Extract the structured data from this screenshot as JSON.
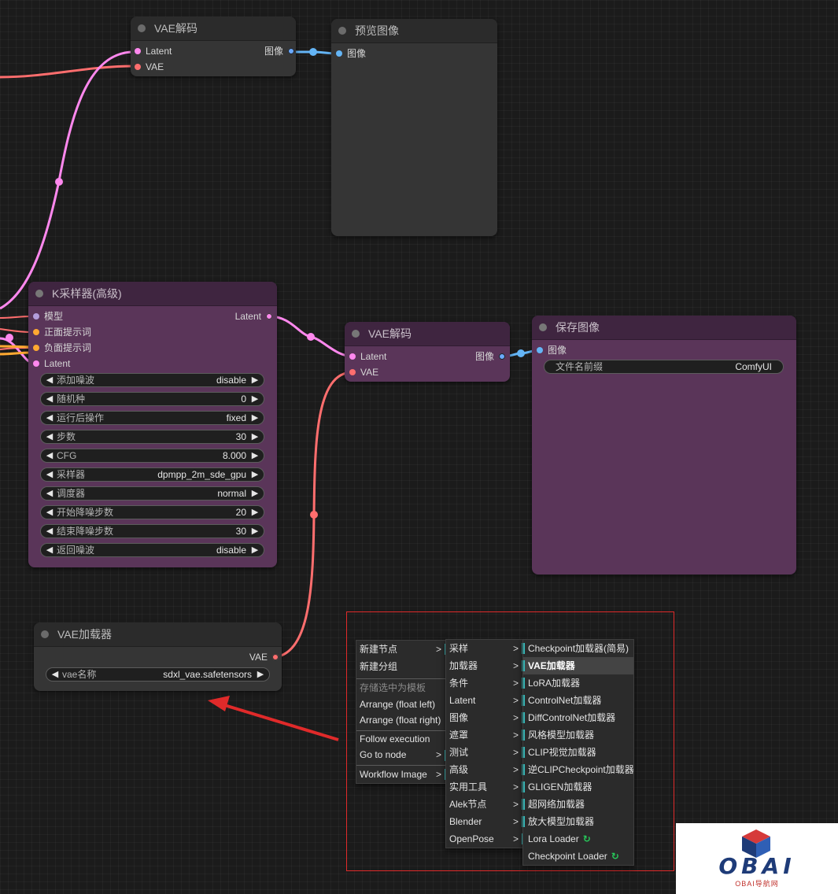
{
  "top_vae_decode": {
    "title": "VAE解码",
    "inputs": [
      "Latent",
      "VAE"
    ],
    "output": "图像"
  },
  "preview_image": {
    "title": "预览图像",
    "input": "图像"
  },
  "ksampler": {
    "title": "K采样器(高级)",
    "inputs": [
      "模型",
      "正面提示词",
      "负面提示词",
      "Latent"
    ],
    "output": "Latent",
    "widgets": [
      {
        "label": "添加噪波",
        "value": "disable"
      },
      {
        "label": "随机种",
        "value": "0"
      },
      {
        "label": "运行后操作",
        "value": "fixed"
      },
      {
        "label": "步数",
        "value": "30"
      },
      {
        "label": "CFG",
        "value": "8.000"
      },
      {
        "label": "采样器",
        "value": "dpmpp_2m_sde_gpu"
      },
      {
        "label": "调度器",
        "value": "normal"
      },
      {
        "label": "开始降噪步数",
        "value": "20"
      },
      {
        "label": "结束降噪步数",
        "value": "30"
      },
      {
        "label": "返回噪波",
        "value": "disable"
      }
    ]
  },
  "mid_vae_decode": {
    "title": "VAE解码",
    "inputs": [
      "Latent",
      "VAE"
    ],
    "output": "图像"
  },
  "save_image": {
    "title": "保存图像",
    "input": "图像",
    "widget": {
      "label": "文件名前缀",
      "value": "ComfyUI"
    }
  },
  "vae_loader": {
    "title": "VAE加载器",
    "output": "VAE",
    "widget": {
      "label": "vae名称",
      "value": "sdxl_vae.safetensors"
    }
  },
  "context_menu": {
    "level1": [
      {
        "label": "新建节点",
        "submenu": true
      },
      {
        "label": "新建分组"
      },
      {
        "label": "存储选中为模板",
        "disabled": true,
        "separator": true
      },
      {
        "label": "Arrange (float left)"
      },
      {
        "label": "Arrange (float right)"
      },
      {
        "label": "Follow execution",
        "separator": true
      },
      {
        "label": "Go to node",
        "submenu": true
      },
      {
        "label": "Workflow Image",
        "submenu": true,
        "separator": true
      }
    ],
    "level2": [
      "采样",
      "加载器",
      "条件",
      "Latent",
      "图像",
      "遮罩",
      "测试",
      "高级",
      "实用工具",
      "Alek节点",
      "Blender",
      "OpenPose"
    ],
    "level3": [
      {
        "label": "Checkpoint加载器(简易)"
      },
      {
        "label": "VAE加载器",
        "highlighted": true
      },
      {
        "label": "LoRA加载器"
      },
      {
        "label": "ControlNet加载器"
      },
      {
        "label": "DiffControlNet加载器"
      },
      {
        "label": "风格模型加载器"
      },
      {
        "label": "CLIP视觉加载器"
      },
      {
        "label": "逆CLIPCheckpoint加载器"
      },
      {
        "label": "GLIGEN加载器"
      },
      {
        "label": "超网络加载器"
      },
      {
        "label": "放大模型加载器"
      },
      {
        "label": "Lora Loader",
        "icon": "custom-node-icon"
      },
      {
        "label": "Checkpoint Loader",
        "icon": "custom-node-icon"
      }
    ]
  },
  "watermark": {
    "logo_text": "OBAI",
    "subtitle": "OBAI导航网"
  },
  "colors": {
    "canvas_bg": "#1b1b1b",
    "node_bg": "#353535",
    "node_purple": "#5a3559",
    "latent_link": "#ff88ee",
    "vae_link": "#ff6e6e",
    "image_link": "#64b5f6",
    "conditioning_slot": "#ffa931",
    "model_slot": "#b39ddb",
    "highlight_box": "#e02a2a"
  }
}
